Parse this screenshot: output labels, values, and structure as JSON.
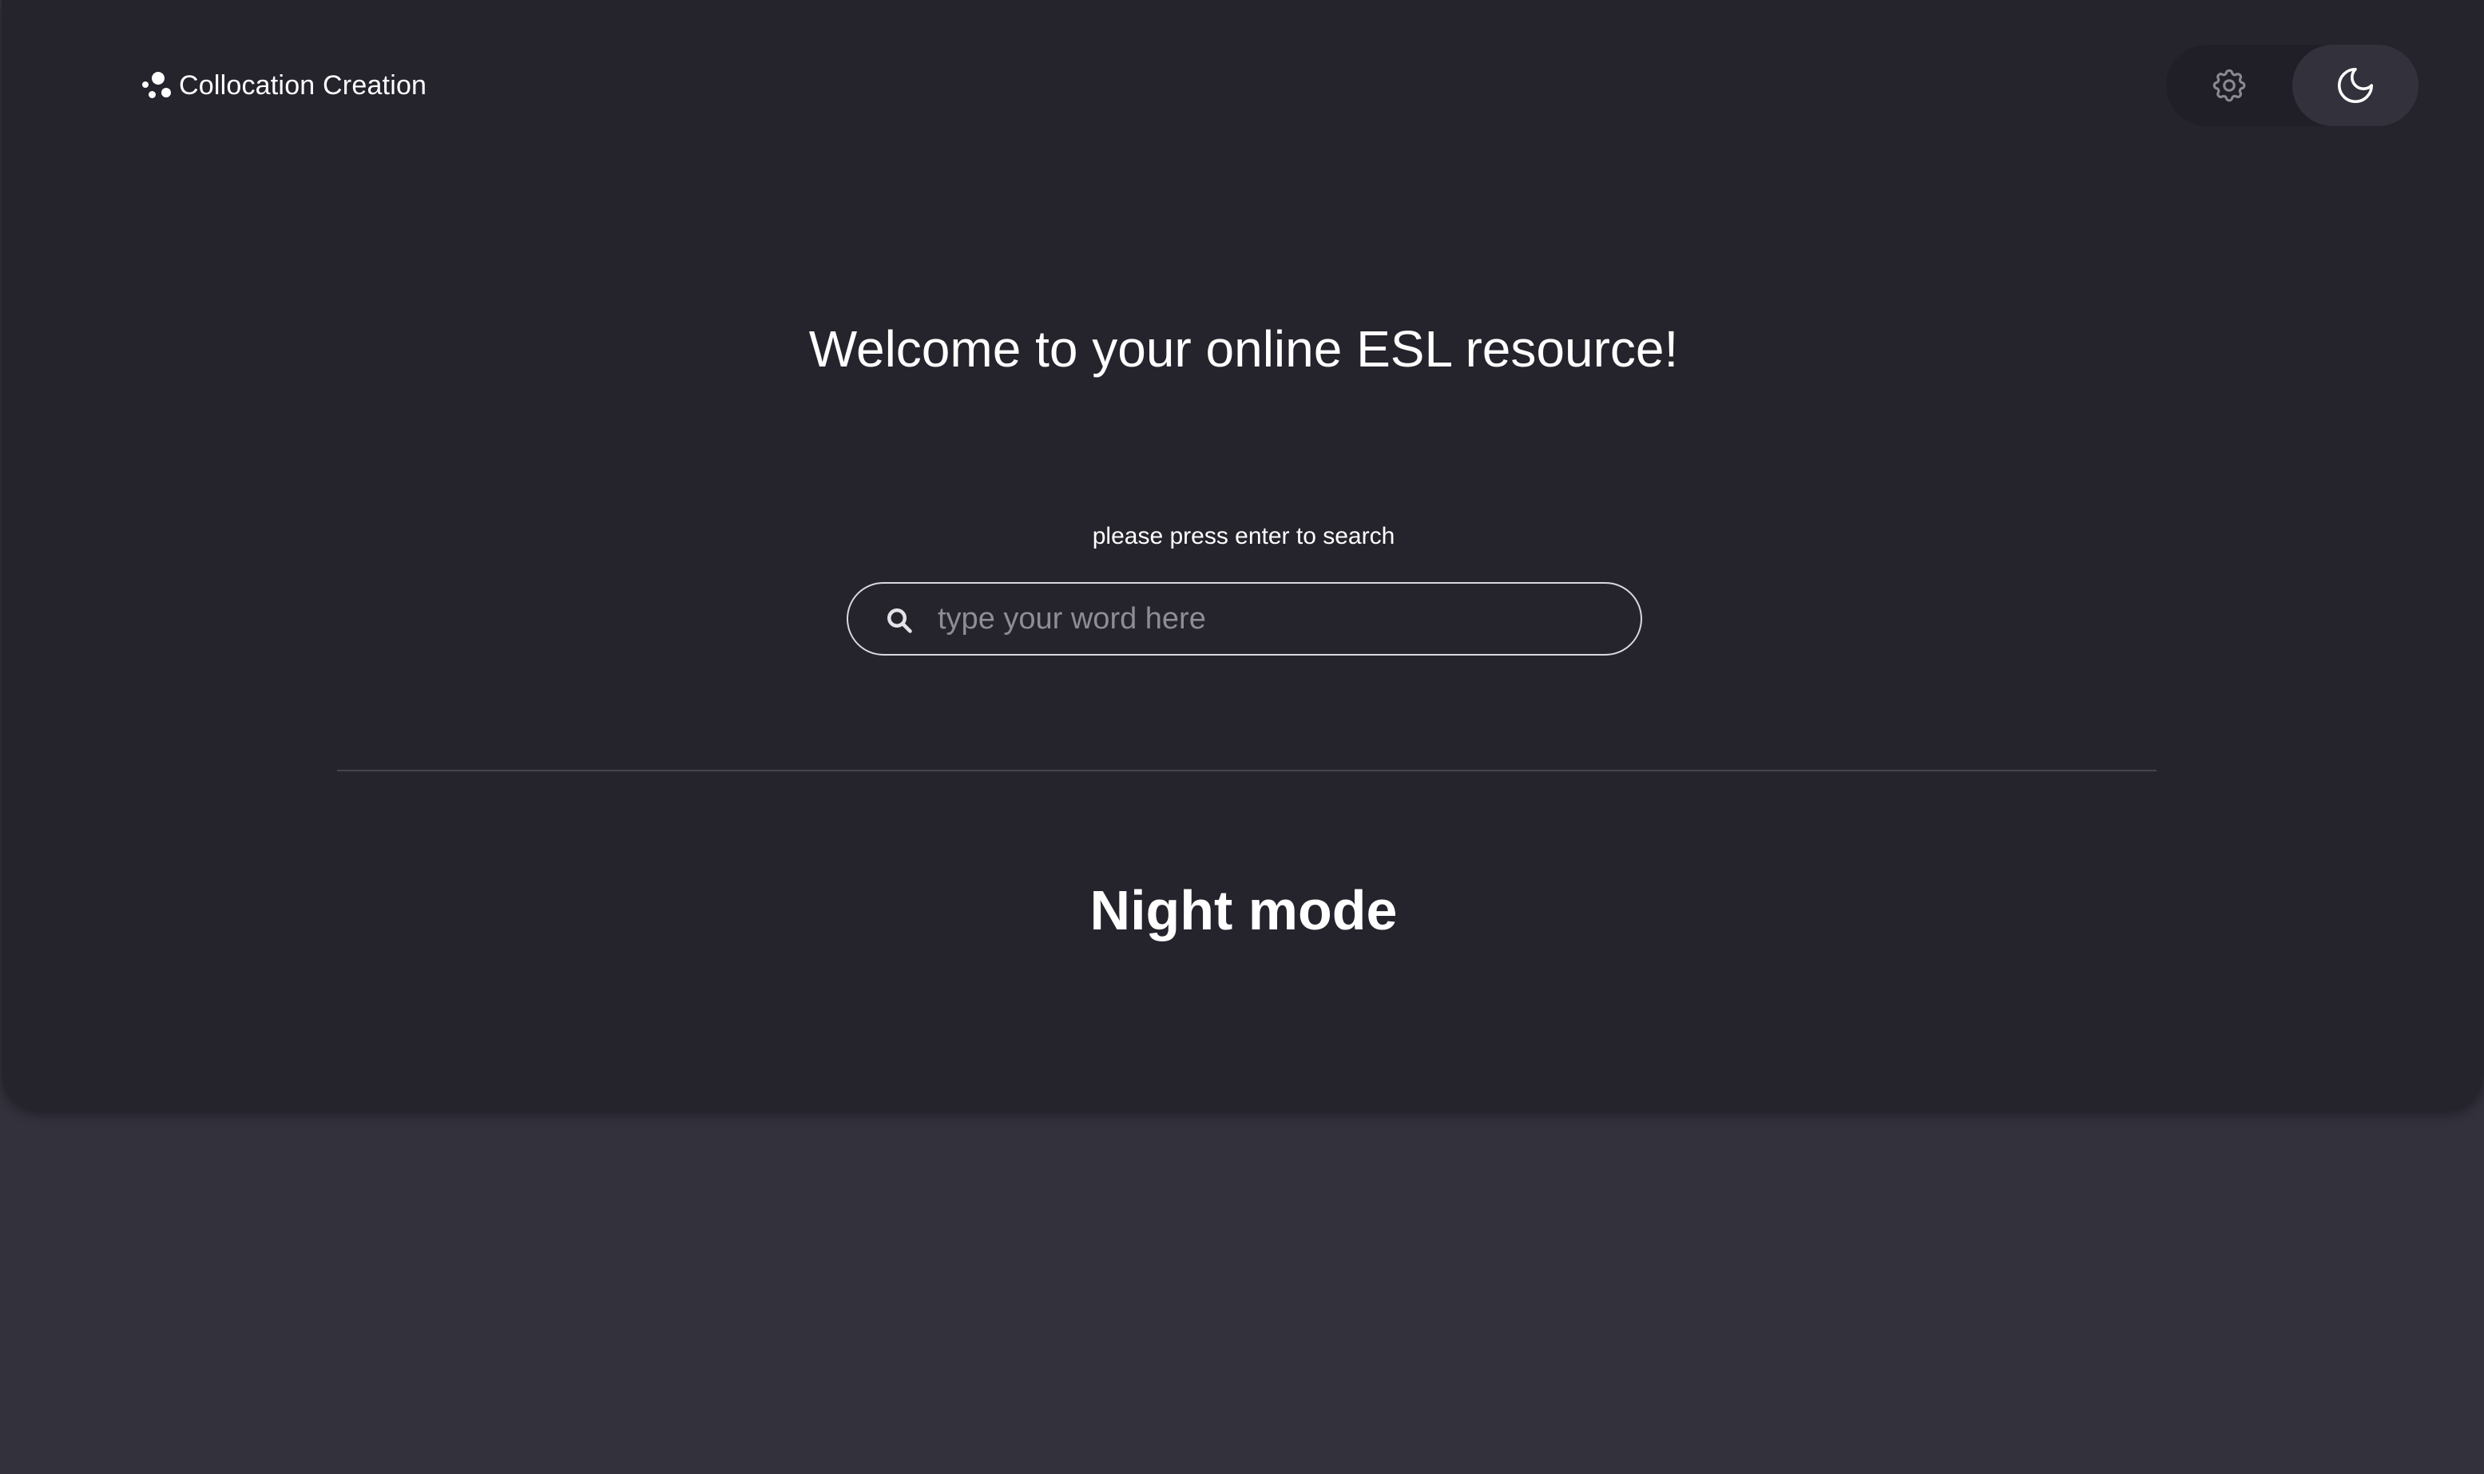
{
  "brand": {
    "name": "Collocation Creation",
    "logo_icon": "three-dots-logo"
  },
  "theme_toggle": {
    "light_icon": "gear-icon",
    "dark_icon": "moon-icon",
    "active": "dark"
  },
  "main": {
    "welcome": "Welcome to your online ESL resource!",
    "hint": "please press enter to search",
    "search": {
      "placeholder": "type your word here",
      "value": "",
      "icon": "search-icon"
    },
    "mode_title": "Night mode"
  },
  "colors": {
    "page_bg": "#33313c",
    "card_bg": "#25242d",
    "text": "#ffffff",
    "active_toggle_bg": "#33323c"
  }
}
